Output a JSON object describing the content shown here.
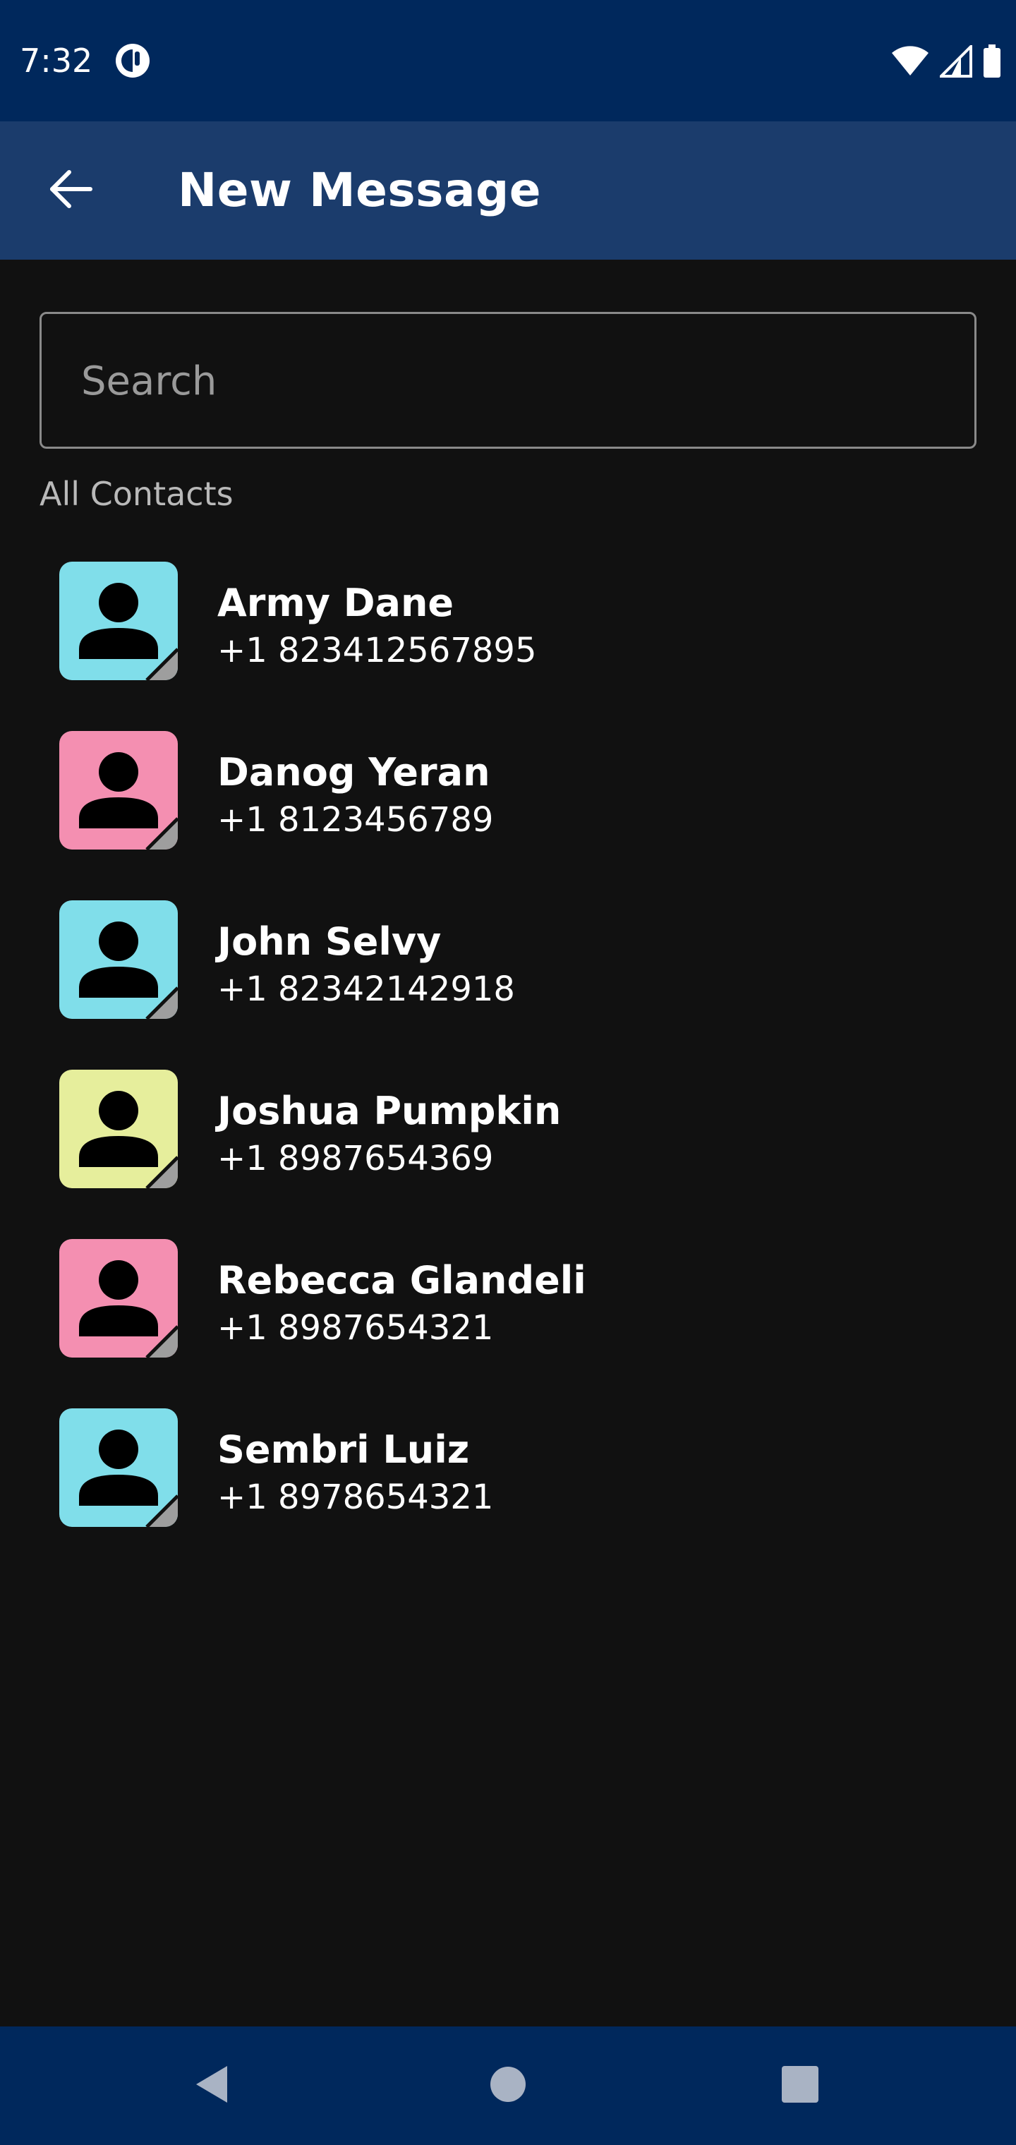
{
  "status_bar": {
    "time": "7:32",
    "app_icon": "app-notification-icon",
    "icons": [
      "wifi-icon",
      "cellular-signal-icon",
      "battery-icon"
    ]
  },
  "app_bar": {
    "title": "New Message",
    "back_icon": "arrow-back-icon",
    "background": "#1b3c6c"
  },
  "search": {
    "placeholder": "Search",
    "value": ""
  },
  "section": {
    "label": "All Contacts"
  },
  "contacts": [
    {
      "name": "Army Dane",
      "phone": "+1 823412567895",
      "avatar_color": "#80deea"
    },
    {
      "name": "Danog Yeran",
      "phone": "+1 8123456789",
      "avatar_color": "#f48fb1"
    },
    {
      "name": "John Selvy",
      "phone": "+1 82342142918",
      "avatar_color": "#80deea"
    },
    {
      "name": "Joshua Pumpkin",
      "phone": "+1 8987654369",
      "avatar_color": "#e6ee9c"
    },
    {
      "name": "Rebecca Glandeli",
      "phone": "+1 8987654321",
      "avatar_color": "#f48fb1"
    },
    {
      "name": "Sembri Luiz",
      "phone": "+1 8978654321",
      "avatar_color": "#80deea"
    }
  ],
  "nav_bar": {
    "buttons": [
      "back-triangle-icon",
      "home-circle-icon",
      "recents-square-icon"
    ],
    "background": "#00285c"
  }
}
